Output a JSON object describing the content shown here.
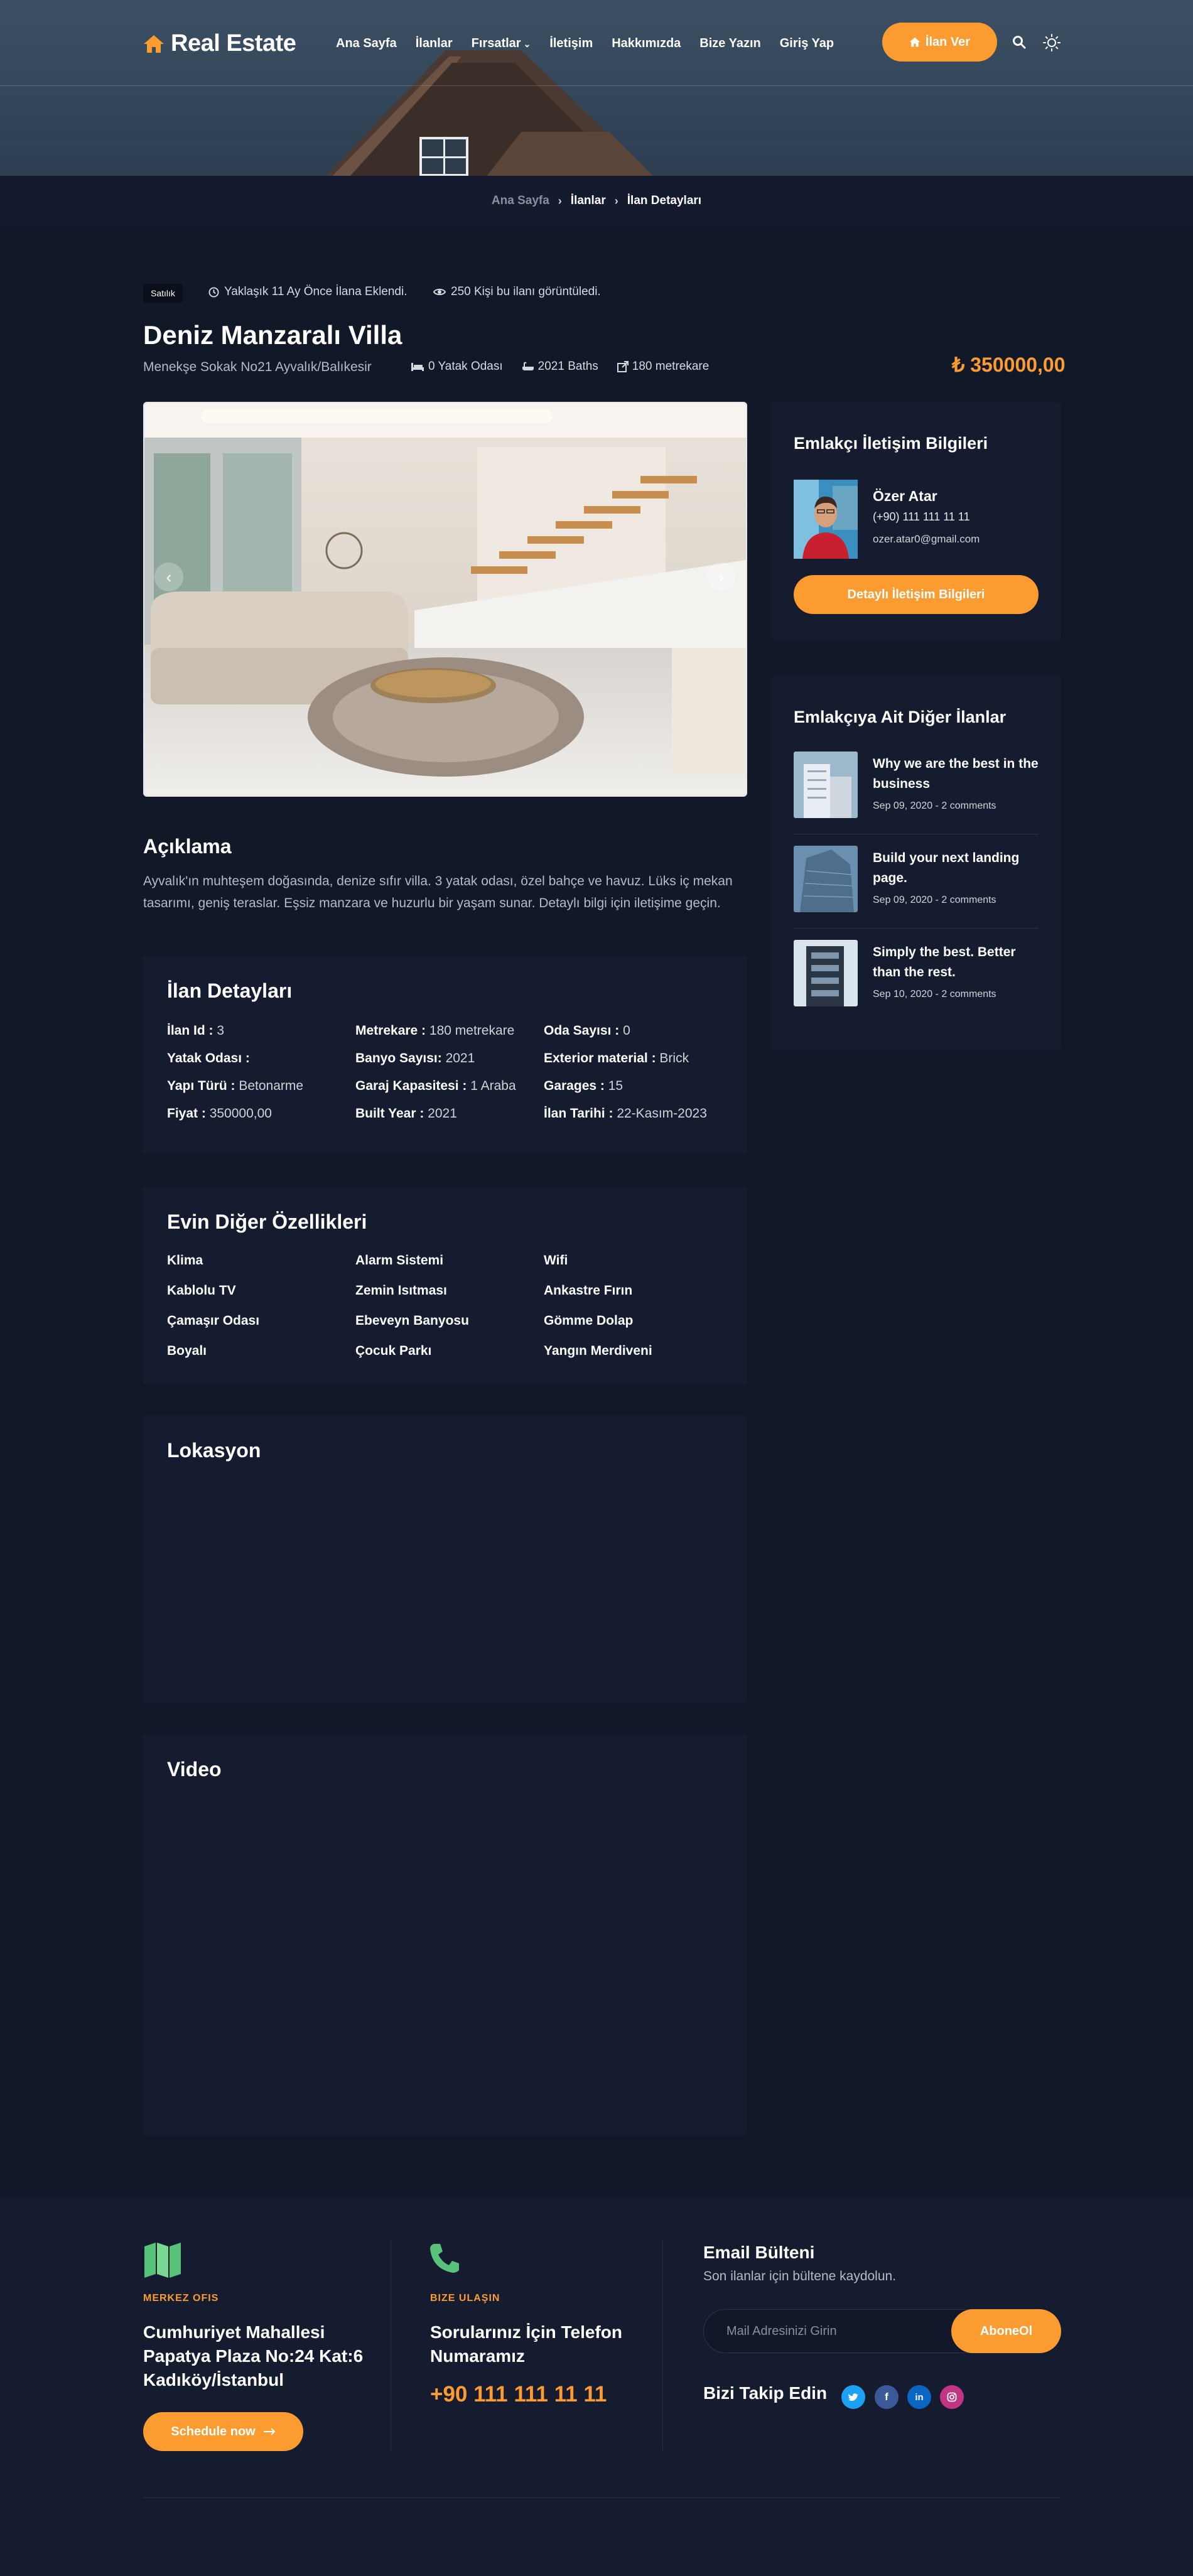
{
  "header": {
    "brand": "Real Estate",
    "nav": [
      {
        "label": "Ana Sayfa"
      },
      {
        "label": "İlanlar"
      },
      {
        "label": "Fırsatlar",
        "dropdown": true
      },
      {
        "label": "İletişim"
      },
      {
        "label": "Hakkımızda"
      },
      {
        "label": "Bize Yazın"
      },
      {
        "label": "Giriş Yap"
      }
    ],
    "cta_label": "İlan Ver",
    "colors": {
      "accent": "#fb9b30",
      "background": "#111827",
      "panel": "#161c2f"
    }
  },
  "breadcrumb": {
    "items": [
      "Ana Sayfa",
      "İlanlar",
      "İlan Detayları"
    ],
    "separator": "›"
  },
  "listing": {
    "status": "Satılık",
    "added": "Yaklaşık 11 Ay Önce İlana Eklendi.",
    "views": "250 Kişi bu ilanı görüntüledi.",
    "title": "Deniz Manzaralı Villa",
    "address": "Menekşe Sokak No21 Ayvalık/Balıkesir",
    "specs": {
      "bedrooms": "0 Yatak Odası",
      "baths": "2021 Baths",
      "area": "180 metrekare"
    },
    "price": "₺ 350000,00"
  },
  "gallery": {
    "prev": "‹",
    "next": "›"
  },
  "description": {
    "title": "Açıklama",
    "text": "Ayvalık'ın muhteşem doğasında, denize sıfır villa. 3 yatak odası, özel bahçe ve havuz. Lüks iç mekan tasarımı, geniş teraslar. Eşsiz manzara ve huzurlu bir yaşam sunar. Detaylı bilgi için iletişime geçin."
  },
  "details": {
    "title": "İlan Detayları",
    "rows": [
      [
        {
          "k": "İlan Id :",
          "v": "3"
        },
        {
          "k": "Metrekare :",
          "v": "180 metrekare"
        },
        {
          "k": "Oda Sayısı :",
          "v": "0"
        }
      ],
      [
        {
          "k": "Yatak Odası :",
          "v": ""
        },
        {
          "k": "Banyo Sayısı:",
          "v": "2021"
        },
        {
          "k": "Exterior material :",
          "v": "Brick"
        }
      ],
      [
        {
          "k": "Yapı Türü :",
          "v": "Betonarme"
        },
        {
          "k": "Garaj Kapasitesi :",
          "v": "1 Araba"
        },
        {
          "k": "Garages :",
          "v": "15"
        }
      ],
      [
        {
          "k": "Fiyat :",
          "v": "350000,00"
        },
        {
          "k": "Built Year :",
          "v": "2021"
        },
        {
          "k": "İlan Tarihi :",
          "v": "22-Kasım-2023"
        }
      ]
    ]
  },
  "features": {
    "title": "Evin Diğer Özellikleri",
    "items": [
      "Klima",
      "Alarm Sistemi",
      "Wifi",
      "Kablolu TV",
      "Zemin Isıtması",
      "Ankastre Fırın",
      "Çamaşır Odası",
      "Ebeveyn Banyosu",
      "Gömme Dolap",
      "Boyalı",
      "Çocuk Parkı",
      "Yangın Merdiveni"
    ]
  },
  "location": {
    "title": "Lokasyon"
  },
  "video": {
    "title": "Video"
  },
  "agent": {
    "title": "Emlakçı İletişim Bilgileri",
    "name": "Özer Atar",
    "phone": "(+90) 111 111 11 11",
    "email": "ozer.atar0@gmail.com",
    "button": "Detaylı İletişim Bilgileri"
  },
  "other_listings": {
    "title": "Emlakçıya Ait Diğer İlanlar",
    "posts": [
      {
        "title": "Why we are the best in the business",
        "meta": "Sep 09, 2020 - 2 comments"
      },
      {
        "title": "Build your next landing page.",
        "meta": "Sep 09, 2020 - 2 comments"
      },
      {
        "title": "Simply the best. Better than the rest.",
        "meta": "Sep 10, 2020 - 2 comments"
      }
    ]
  },
  "footer": {
    "office": {
      "label": "MERKEZ OFIS",
      "address": "Cumhuriyet Mahallesi Papatya Plaza No:24 Kat:6 Kadıköy/İstanbul",
      "button": "Schedule now"
    },
    "contact": {
      "label": "BIZE ULAŞIN",
      "text": "Sorularınız İçin Telefon Numaramız",
      "phone": "+90 111 111 11 11"
    },
    "newsletter": {
      "title": "Email Bülteni",
      "subtitle": "Son ilanlar için bültene kaydolun.",
      "placeholder": "Mail Adresinizi Girin",
      "button": "AboneOl"
    },
    "follow": {
      "title": "Bizi Takip Edin",
      "icons": [
        "twitter-icon",
        "facebook-icon",
        "linkedin-icon",
        "instagram-icon"
      ]
    }
  }
}
